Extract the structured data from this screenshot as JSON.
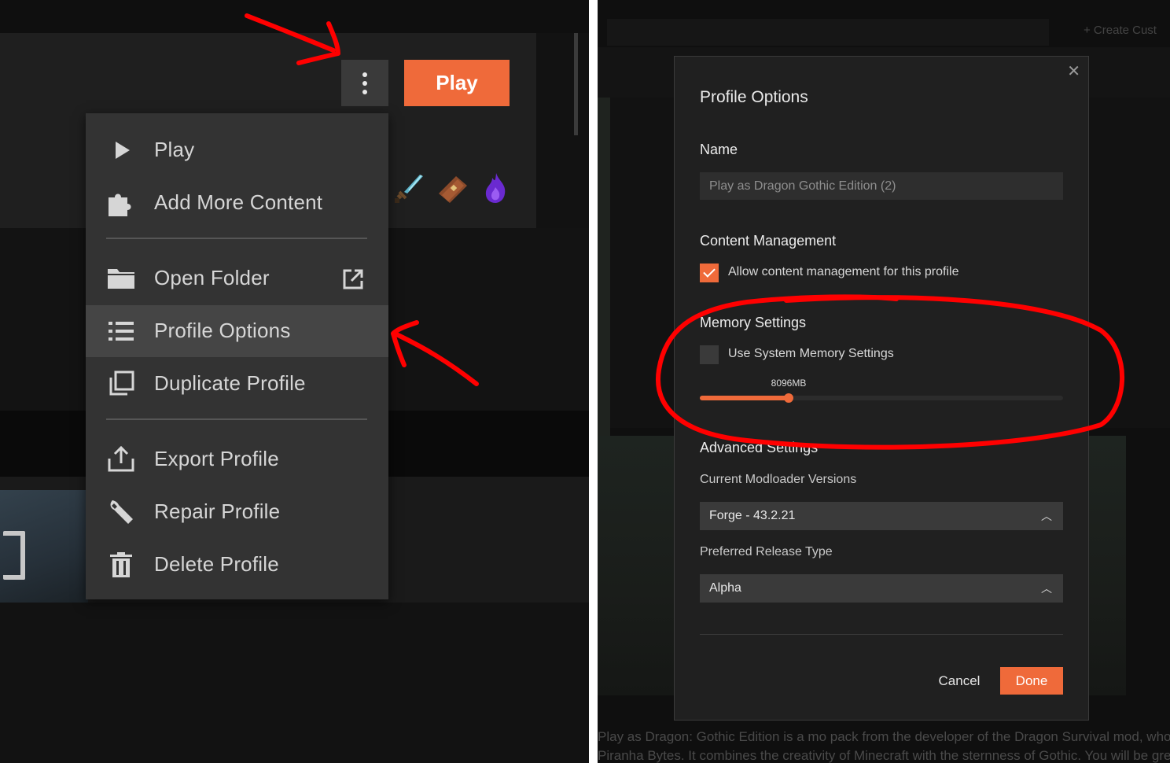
{
  "left_panel": {
    "play_button": "Play",
    "more_options_icon": "vertical-dots-icon",
    "game_icons": [
      "diamond-sword-icon",
      "book-icon",
      "purple-flame-icon"
    ],
    "context_menu": {
      "items": [
        {
          "label": "Play",
          "icon": "play-icon"
        },
        {
          "label": "Add More Content",
          "icon": "puzzle-icon"
        },
        {
          "label": "Open Folder",
          "icon": "folder-icon",
          "trailing_icon": "external-link-icon"
        },
        {
          "label": "Profile Options",
          "icon": "list-icon",
          "highlighted": true
        },
        {
          "label": "Duplicate Profile",
          "icon": "duplicate-icon"
        },
        {
          "label": "Export Profile",
          "icon": "export-icon"
        },
        {
          "label": "Repair Profile",
          "icon": "wrench-icon"
        },
        {
          "label": "Delete Profile",
          "icon": "trash-icon"
        }
      ]
    }
  },
  "right_panel": {
    "background": {
      "create_label": "+ Create Cust",
      "description_text_line1": "Play as Dragon: Gothic Edition is a mo pack from the developer of the Dragon Survival mod, who loves the games from",
      "description_text_line2": "Piranha Bytes. It combines the creativity of Minecraft with the sternness of Gothic. You will be greeted by a variety of cruel"
    },
    "dialog": {
      "title": "Profile Options",
      "close_icon": "close-icon",
      "name_section": "Name",
      "name_value": "Play as Dragon Gothic Edition (2)",
      "content_section": "Content Management",
      "allow_content_label": "Allow content management for this profile",
      "allow_content_checked": true,
      "memory_section": "Memory Settings",
      "use_system_memory_label": "Use System Memory Settings",
      "use_system_memory_checked": false,
      "memory_value_label": "8096MB",
      "memory_fraction": 0.245,
      "advanced_section": "Advanced Settings",
      "modloader_label": "Current Modloader Versions",
      "modloader_value": "Forge - 43.2.21",
      "release_type_label": "Preferred Release Type",
      "release_type_value": "Alpha",
      "cancel_label": "Cancel",
      "done_label": "Done"
    }
  },
  "colors": {
    "accent": "#ef6a3a",
    "annotation": "#ff0000",
    "menu_bg": "#333333",
    "dialog_bg": "#202020"
  }
}
